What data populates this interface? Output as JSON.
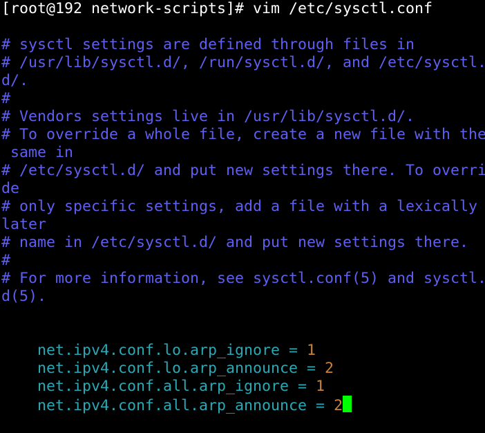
{
  "terminal": {
    "prompt": "[root@192 network-scripts]# vim /etc/sysctl.conf",
    "comments": [
      "# sysctl settings are defined through files in",
      "# /usr/lib/sysctl.d/, /run/sysctl.d/, and /etc/sysctl.",
      "d/.",
      "#",
      "# Vendors settings live in /usr/lib/sysctl.d/.",
      "# To override a whole file, create a new file with the",
      " same in",
      "# /etc/sysctl.d/ and put new settings there. To overri",
      "de",
      "# only specific settings, add a file with a lexically",
      "later",
      "# name in /etc/sysctl.d/ and put new settings there.",
      "#",
      "# For more information, see sysctl.conf(5) and sysctl.",
      "d(5)."
    ],
    "settings": [
      {
        "key": "net.ipv4.conf.lo.arp_ignore",
        "op": " = ",
        "value": "1"
      },
      {
        "key": "net.ipv4.conf.lo.arp_announce",
        "op": " = ",
        "value": "2"
      },
      {
        "key": "net.ipv4.conf.all.arp_ignore",
        "op": " = ",
        "value": "1"
      },
      {
        "key": "net.ipv4.conf.all.arp_announce",
        "op": " = ",
        "value": "2"
      }
    ],
    "colors": {
      "background": "#000000",
      "prompt": "#ffffff",
      "comment": "#5f5ff0",
      "key": "#2aa8b4",
      "value": "#c8843c",
      "cursor": "#00ff00"
    }
  }
}
